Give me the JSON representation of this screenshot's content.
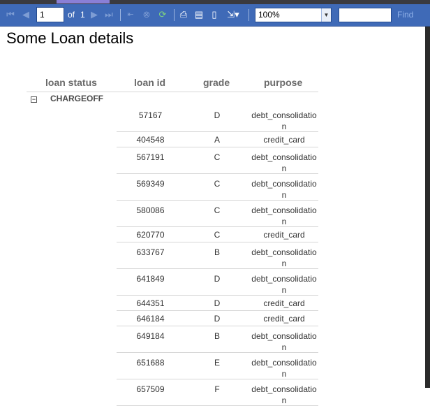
{
  "toolbar": {
    "current_page": "1",
    "of_label": "of",
    "total_pages": "1",
    "zoom": "100%",
    "find_label": "Find",
    "icons": [
      "first-page-icon",
      "previous-page-icon",
      "next-page-icon",
      "last-page-icon",
      "back-icon",
      "stop-icon",
      "refresh-icon",
      "print-icon",
      "print-layout-icon",
      "page-setup-icon",
      "export-icon"
    ]
  },
  "report": {
    "title": "Some Loan details",
    "headers": {
      "loan_status": "loan status",
      "loan_id": "loan id",
      "grade": "grade",
      "purpose": "purpose"
    },
    "group": {
      "expander": "⊟",
      "name": "CHARGEOFF",
      "rows": [
        {
          "id": "57167",
          "grade": "D",
          "purpose": "debt_consolidation"
        },
        {
          "id": "404548",
          "grade": "A",
          "purpose": "credit_card"
        },
        {
          "id": "567191",
          "grade": "C",
          "purpose": "debt_consolidation"
        },
        {
          "id": "569349",
          "grade": "C",
          "purpose": "debt_consolidation"
        },
        {
          "id": "580086",
          "grade": "C",
          "purpose": "debt_consolidation"
        },
        {
          "id": "620770",
          "grade": "C",
          "purpose": "credit_card"
        },
        {
          "id": "633767",
          "grade": "B",
          "purpose": "debt_consolidation"
        },
        {
          "id": "641849",
          "grade": "D",
          "purpose": "debt_consolidation"
        },
        {
          "id": "644351",
          "grade": "D",
          "purpose": "credit_card"
        },
        {
          "id": "646184",
          "grade": "D",
          "purpose": "credit_card"
        },
        {
          "id": "649184",
          "grade": "B",
          "purpose": "debt_consolidation"
        },
        {
          "id": "651688",
          "grade": "E",
          "purpose": "debt_consolidation"
        },
        {
          "id": "657509",
          "grade": "F",
          "purpose": "debt_consolidation"
        }
      ]
    }
  }
}
